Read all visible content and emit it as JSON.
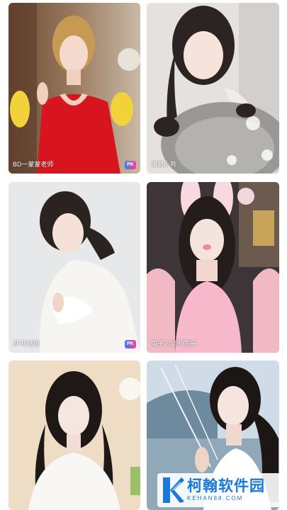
{
  "streams": [
    {
      "name": "BD一蒙蒙老师",
      "pk_badge": "PK",
      "theme": "red-dress"
    },
    {
      "name": "诸葛小熊",
      "pk_badge": "",
      "theme": "plush-bear"
    },
    {
      "name": "ZF灰姑娘",
      "pk_badge": "PK",
      "theme": "white-fur"
    },
    {
      "name": "兔子人间不值得",
      "pk_badge": "",
      "theme": "bunny-filter"
    },
    {
      "name": "",
      "pk_badge": "",
      "theme": "white-coat"
    },
    {
      "name": "",
      "pk_badge": "",
      "theme": "harbor"
    }
  ],
  "watermark": {
    "title": "柯翰软件园",
    "url": "KEHAN88.COM",
    "logo_letter": "K"
  },
  "colors": {
    "pk_left": "#3a7bff",
    "pk_right": "#ff3d8b",
    "watermark_blue": "#1a78d8"
  }
}
